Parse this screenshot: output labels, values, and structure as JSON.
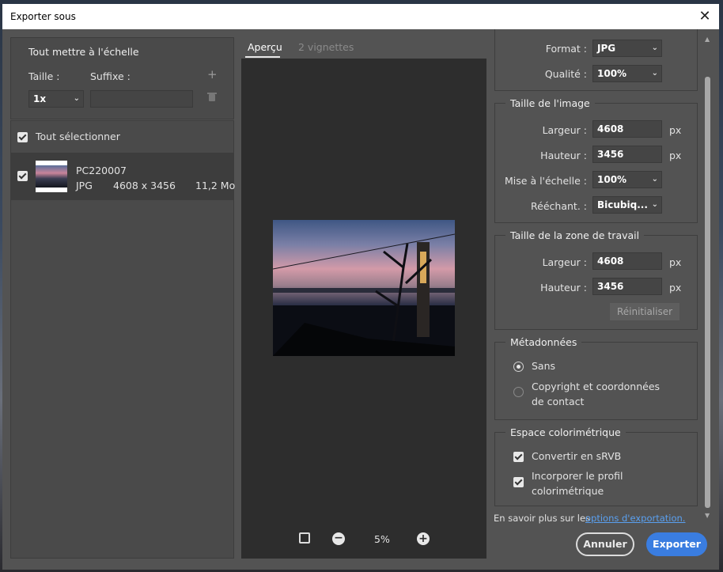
{
  "window": {
    "title": "Exporter sous",
    "close_label": "✕"
  },
  "left": {
    "scale_section": {
      "title": "Tout mettre à l'échelle",
      "size_label": "Taille :",
      "suffix_label": "Suffixe :",
      "size_value": "1x",
      "suffix_value": "",
      "add_icon": "+",
      "delete_icon": "trash-icon"
    },
    "select_all_label": "Tout sélectionner",
    "file": {
      "name": "PC220007",
      "format": "JPG",
      "dimensions": "4608 x 3456",
      "filesize": "11,2 Mo"
    }
  },
  "preview": {
    "tabs": [
      {
        "label": "Aperçu",
        "active": true
      },
      {
        "label": "2 vignettes",
        "active": false
      }
    ],
    "zoom": "5%"
  },
  "right": {
    "format_label": "Format :",
    "format_value": "JPG",
    "quality_label": "Qualité :",
    "quality_value": "100%",
    "image_size": {
      "title": "Taille de l'image",
      "width_label": "Largeur :",
      "width_value": "4608",
      "height_label": "Hauteur :",
      "height_value": "3456",
      "unit": "px",
      "scale_label": "Mise à l'échelle :",
      "scale_value": "100%",
      "resample_label": "Rééchant. :",
      "resample_value": "Bicubiq..."
    },
    "canvas_size": {
      "title": "Taille de la zone de travail",
      "width_label": "Largeur :",
      "width_value": "4608",
      "height_label": "Hauteur :",
      "height_value": "3456",
      "unit": "px",
      "reset_label": "Réinitialiser"
    },
    "metadata": {
      "title": "Métadonnées",
      "option_none": "Sans",
      "option_copyright": "Copyright et coordonnées de contact"
    },
    "color_space": {
      "title": "Espace colorimétrique",
      "convert_label": "Convertir en sRVB",
      "embed_label": "Incorporer le profil colorimétrique"
    }
  },
  "footer": {
    "learn_more_prefix": "En savoir plus sur les",
    "learn_more_link": "options d'exportation.",
    "cancel_label": "Annuler",
    "export_label": "Exporter"
  },
  "colors": {
    "accent": "#3a7de0",
    "link": "#5aa0f0",
    "dialog_bg": "#535353"
  }
}
